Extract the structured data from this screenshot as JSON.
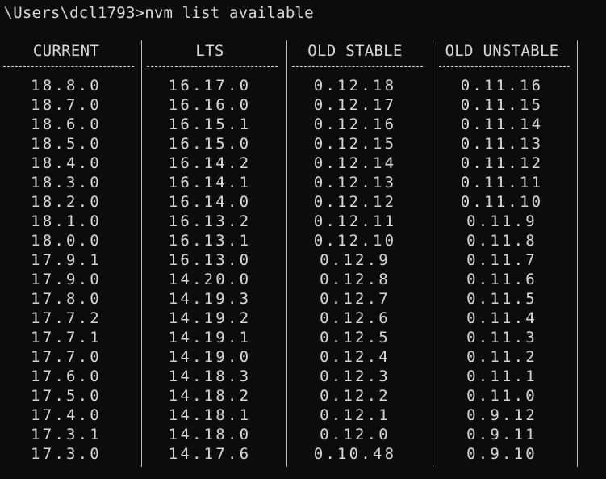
{
  "terminal": {
    "prompt": ":\\Users\\dcl1793>",
    "command": "nvm list available"
  },
  "table": {
    "headers": [
      "CURRENT",
      "LTS",
      "OLD STABLE",
      "OLD UNSTABLE"
    ],
    "columns": {
      "current": [
        "18.8.0",
        "18.7.0",
        "18.6.0",
        "18.5.0",
        "18.4.0",
        "18.3.0",
        "18.2.0",
        "18.1.0",
        "18.0.0",
        "17.9.1",
        "17.9.0",
        "17.8.0",
        "17.7.2",
        "17.7.1",
        "17.7.0",
        "17.6.0",
        "17.5.0",
        "17.4.0",
        "17.3.1",
        "17.3.0"
      ],
      "lts": [
        "16.17.0",
        "16.16.0",
        "16.15.1",
        "16.15.0",
        "16.14.2",
        "16.14.1",
        "16.14.0",
        "16.13.2",
        "16.13.1",
        "16.13.0",
        "14.20.0",
        "14.19.3",
        "14.19.2",
        "14.19.1",
        "14.19.0",
        "14.18.3",
        "14.18.2",
        "14.18.1",
        "14.18.0",
        "14.17.6"
      ],
      "old_stable": [
        "0.12.18",
        "0.12.17",
        "0.12.16",
        "0.12.15",
        "0.12.14",
        "0.12.13",
        "0.12.12",
        "0.12.11",
        "0.12.10",
        "0.12.9",
        "0.12.8",
        "0.12.7",
        "0.12.6",
        "0.12.5",
        "0.12.4",
        "0.12.3",
        "0.12.2",
        "0.12.1",
        "0.12.0",
        "0.10.48"
      ],
      "old_unstable": [
        "0.11.16",
        "0.11.15",
        "0.11.14",
        "0.11.13",
        "0.11.12",
        "0.11.11",
        "0.11.10",
        "0.11.9",
        "0.11.8",
        "0.11.7",
        "0.11.6",
        "0.11.5",
        "0.11.4",
        "0.11.3",
        "0.11.2",
        "0.11.1",
        "0.11.0",
        "0.9.12",
        "0.9.11",
        "0.9.10"
      ]
    }
  },
  "colors": {
    "background": "#0c0c0c",
    "text": "#d8d8d8"
  }
}
